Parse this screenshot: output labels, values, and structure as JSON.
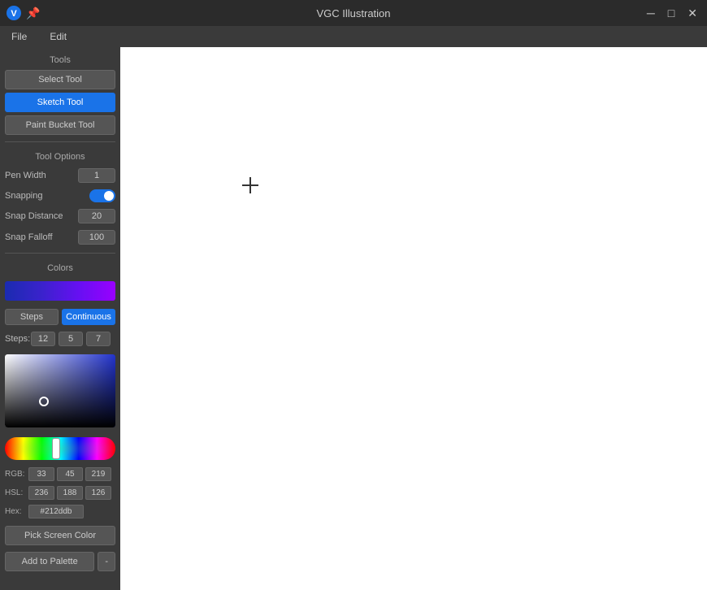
{
  "app": {
    "title": "VGC Illustration",
    "logo_symbol": "V"
  },
  "titlebar": {
    "title": "VGC Illustration",
    "minimize_label": "─",
    "maximize_label": "□",
    "close_label": "✕",
    "pin_label": "📌"
  },
  "menubar": {
    "items": [
      {
        "id": "file",
        "label": "File"
      },
      {
        "id": "edit",
        "label": "Edit"
      }
    ]
  },
  "sidebar": {
    "tools_section": "Tools",
    "tool_options_section": "Tool Options",
    "colors_section": "Colors",
    "select_tool_label": "Select Tool",
    "sketch_tool_label": "Sketch Tool",
    "paint_bucket_label": "Paint Bucket Tool",
    "pen_width_label": "Pen Width",
    "pen_width_value": "1",
    "snapping_label": "Snapping",
    "snap_distance_label": "Snap Distance",
    "snap_distance_value": "20",
    "snap_falloff_label": "Snap Falloff",
    "snap_falloff_value": "100",
    "steps_label": "Steps",
    "continuous_label": "Continuous",
    "steps_prefix": "Steps:",
    "step_1": "12",
    "step_2": "5",
    "step_3": "7",
    "rgb_label": "RGB:",
    "rgb_r": "33",
    "rgb_g": "45",
    "rgb_b": "219",
    "hsl_label": "HSL:",
    "hsl_h": "236",
    "hsl_s": "188",
    "hsl_l": "126",
    "hex_label": "Hex:",
    "hex_value": "#212ddb",
    "pick_screen_label": "Pick Screen Color",
    "add_palette_label": "Add to Palette",
    "remove_palette_label": "-"
  }
}
